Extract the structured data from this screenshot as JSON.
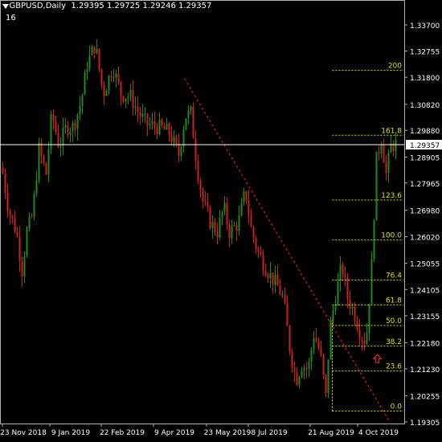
{
  "window": {
    "symbol_tf": "GBPUSD,Daily",
    "ohlc": "1.29395 1.29725 1.29246 1.29357",
    "indicator_value": "16"
  },
  "colors": {
    "background": "#000000",
    "bull": "#1f8a1f",
    "bear": "#cc1f1f",
    "grid_text": "#ffffff",
    "fib": "#e0e000",
    "trend": "#ff2020",
    "price_line": "#ffffff",
    "price_box_bg": "#ffffff",
    "price_box_text": "#000000"
  },
  "price_scale": {
    "ticks": [
      "1.33700",
      "1.32755",
      "1.31800",
      "1.30820",
      "1.29880",
      "1.28905",
      "1.27965",
      "1.26980",
      "1.26020",
      "1.25055",
      "1.24105",
      "1.23155",
      "1.22180",
      "1.21230",
      "1.20255",
      "1.19305"
    ],
    "current_price": "1.29357"
  },
  "time_axis": {
    "labels": [
      "23 Nov 2018",
      "9 Jan 2019",
      "22 Feb 2019",
      "9 Apr 2019",
      "23 May 2019",
      "8 Jul 2019",
      "21 Aug 2019",
      "4 Oct 2019"
    ]
  },
  "fibonacci": {
    "levels": [
      {
        "label": "200",
        "price": 1.3205
      },
      {
        "label": "161.8",
        "price": 1.297
      },
      {
        "label": "123.6",
        "price": 1.2735
      },
      {
        "label": "100.0",
        "price": 1.259
      },
      {
        "label": "76.4",
        "price": 1.2445
      },
      {
        "label": "61.8",
        "price": 1.2355
      },
      {
        "label": "50.0",
        "price": 1.228
      },
      {
        "label": "38.2",
        "price": 1.2205
      },
      {
        "label": "23.6",
        "price": 1.2115
      },
      {
        "label": "0.0",
        "price": 1.197
      }
    ]
  },
  "trendline": {
    "from_date": "2019-04-15",
    "from_price": 1.3175,
    "to_date": "2019-10-14",
    "to_price": 1.193
  },
  "arrow_marker": {
    "icon": "up-arrow-icon",
    "date": "2019-10-03",
    "price": 1.216
  }
}
